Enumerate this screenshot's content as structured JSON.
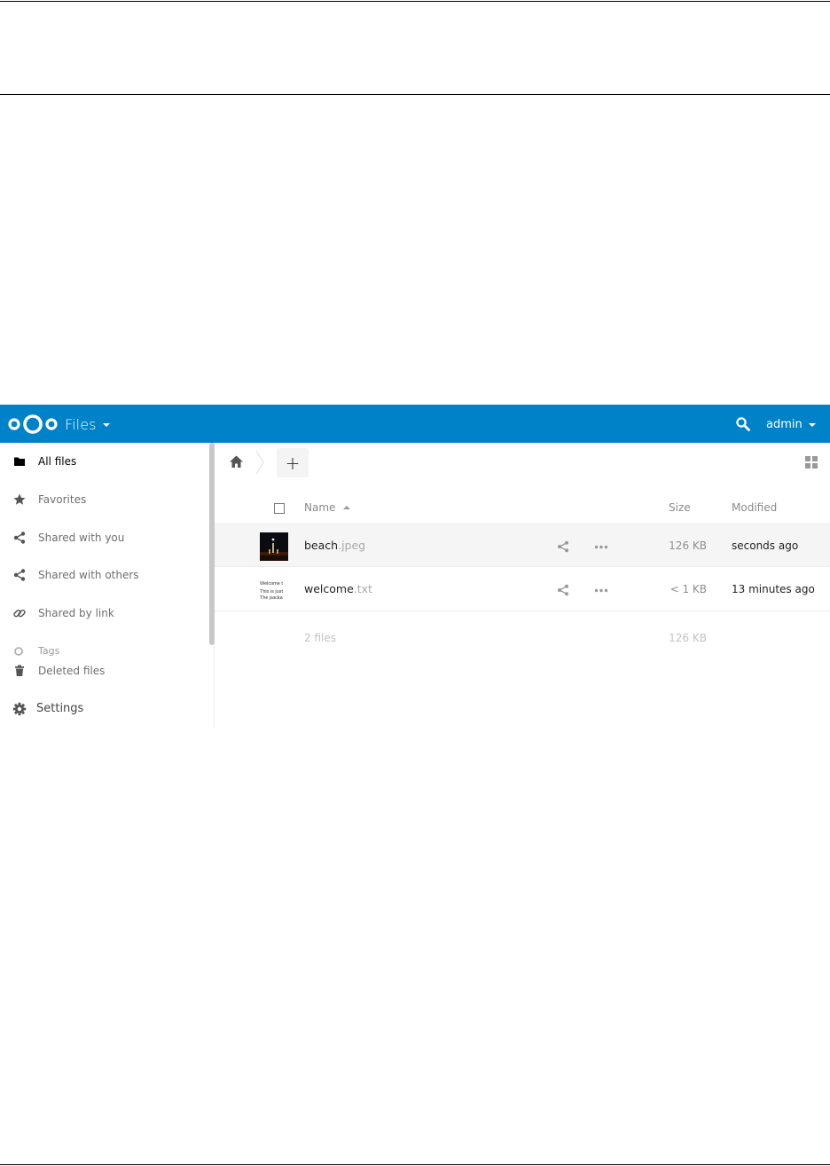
{
  "header": {
    "app_name": "Files",
    "user_name": "admin",
    "brand_color": "#0082c9",
    "logo_icon": "nextcloud-logo-icon",
    "search_icon": "search-icon"
  },
  "sidebar": {
    "items": [
      {
        "label": "All files",
        "icon": "folder-icon",
        "active": true
      },
      {
        "label": "Favorites",
        "icon": "star-icon",
        "active": false
      },
      {
        "label": "Shared with you",
        "icon": "share-icon",
        "active": false
      },
      {
        "label": "Shared with others",
        "icon": "share-icon",
        "active": false
      },
      {
        "label": "Shared by link",
        "icon": "link-icon",
        "active": false
      },
      {
        "label": "Tags",
        "icon": "tag-icon",
        "active": false
      },
      {
        "label": "Deleted files",
        "icon": "trash-icon",
        "active": false
      }
    ],
    "settings_label": "Settings"
  },
  "breadcrumb": {
    "new_label": "+"
  },
  "table": {
    "columns": {
      "name": "Name",
      "size": "Size",
      "modified": "Modified"
    },
    "files": [
      {
        "basename": "beach",
        "extension": ".jpeg",
        "size": "126 KB",
        "modified": "seconds ago",
        "thumbnail": "image-thumbnail"
      },
      {
        "basename": "welcome",
        "extension": ".txt",
        "size": "< 1 KB",
        "modified": "13 minutes ago",
        "thumbnail": "text-thumbnail",
        "preview_lines": [
          "Welcome t",
          "This is just",
          "The packa"
        ]
      }
    ],
    "summary": {
      "count": "2 files",
      "size": "126 KB"
    }
  }
}
